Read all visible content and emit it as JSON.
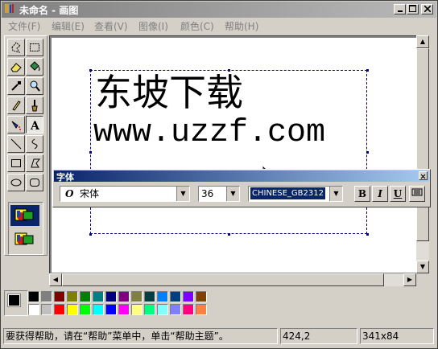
{
  "window": {
    "title": "未命名 - 画图"
  },
  "menu": [
    "文件(F)",
    "编辑(E)",
    "查看(V)",
    "图像(I)",
    "颜色(C)",
    "帮助(H)"
  ],
  "canvas": {
    "text_line1": "东坡下载",
    "text_line2": "www.uzzf.com"
  },
  "fonts_toolbar": {
    "title": "字体",
    "font_name": "宋体",
    "font_size": "36",
    "script": "CHINESE_GB2312",
    "bold_label": "B",
    "italic_label": "I",
    "underline_label": "U"
  },
  "tools": [
    "free-select",
    "rect-select",
    "eraser",
    "fill-bucket",
    "color-picker",
    "magnifier",
    "pencil",
    "brush",
    "airbrush",
    "text",
    "line",
    "curve",
    "rectangle",
    "polygon",
    "ellipse",
    "rounded-rect"
  ],
  "selected_tool": "text",
  "palette": {
    "foreground": "#000000",
    "background": "#ffffff",
    "colors_top": [
      "#000000",
      "#808080",
      "#800000",
      "#808000",
      "#008000",
      "#008080",
      "#000080",
      "#800080",
      "#808040",
      "#004040",
      "#0080ff",
      "#004080",
      "#8000ff",
      "#804000"
    ],
    "colors_bottom": [
      "#ffffff",
      "#c0c0c0",
      "#ff0000",
      "#ffff00",
      "#00ff00",
      "#00ffff",
      "#0000ff",
      "#ff00ff",
      "#ffff80",
      "#00ff80",
      "#80ffff",
      "#8080ff",
      "#ff0080",
      "#ff8040"
    ]
  },
  "status": {
    "help_text": "要获得帮助，请在“帮助”菜单中，单击“帮助主题”。",
    "coords": "424,2",
    "size": "341x84"
  }
}
